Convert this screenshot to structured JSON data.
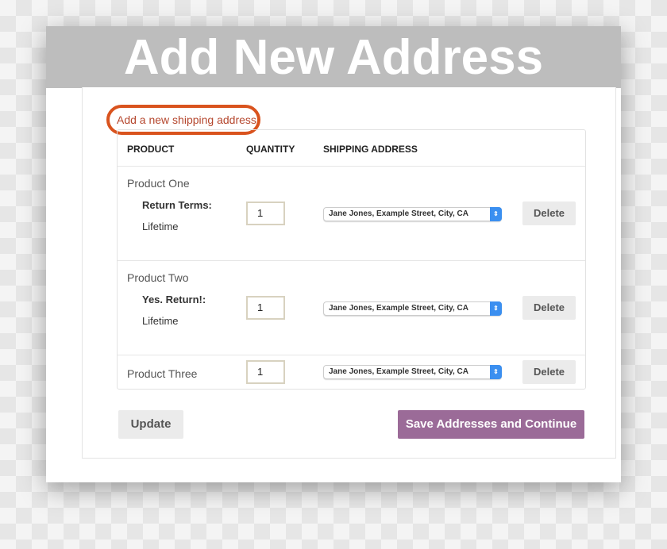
{
  "title": "Add New Address",
  "add_link": "Add a new shipping address",
  "headers": {
    "product": "PRODUCT",
    "quantity": "QUANTITY",
    "shipping": "SHIPPING ADDRESS"
  },
  "rows": [
    {
      "product": "Product One",
      "term_label": "Return Terms:",
      "term_value": "Lifetime",
      "quantity": "1",
      "address": "Jane Jones, Example Street, City, CA",
      "delete": "Delete"
    },
    {
      "product": "Product Two",
      "term_label": "Yes. Return!:",
      "term_value": "Lifetime",
      "quantity": "1",
      "address": "Jane Jones, Example Street, City, CA",
      "delete": "Delete"
    },
    {
      "product": "Product Three",
      "quantity": "1",
      "address": "Jane Jones, Example Street, City, CA",
      "delete": "Delete"
    }
  ],
  "update": "Update",
  "save": "Save Addresses and Continue",
  "colors": {
    "accent": "#9b6b98",
    "highlight": "#d9531e",
    "select_arrow": "#3b8ff0"
  }
}
